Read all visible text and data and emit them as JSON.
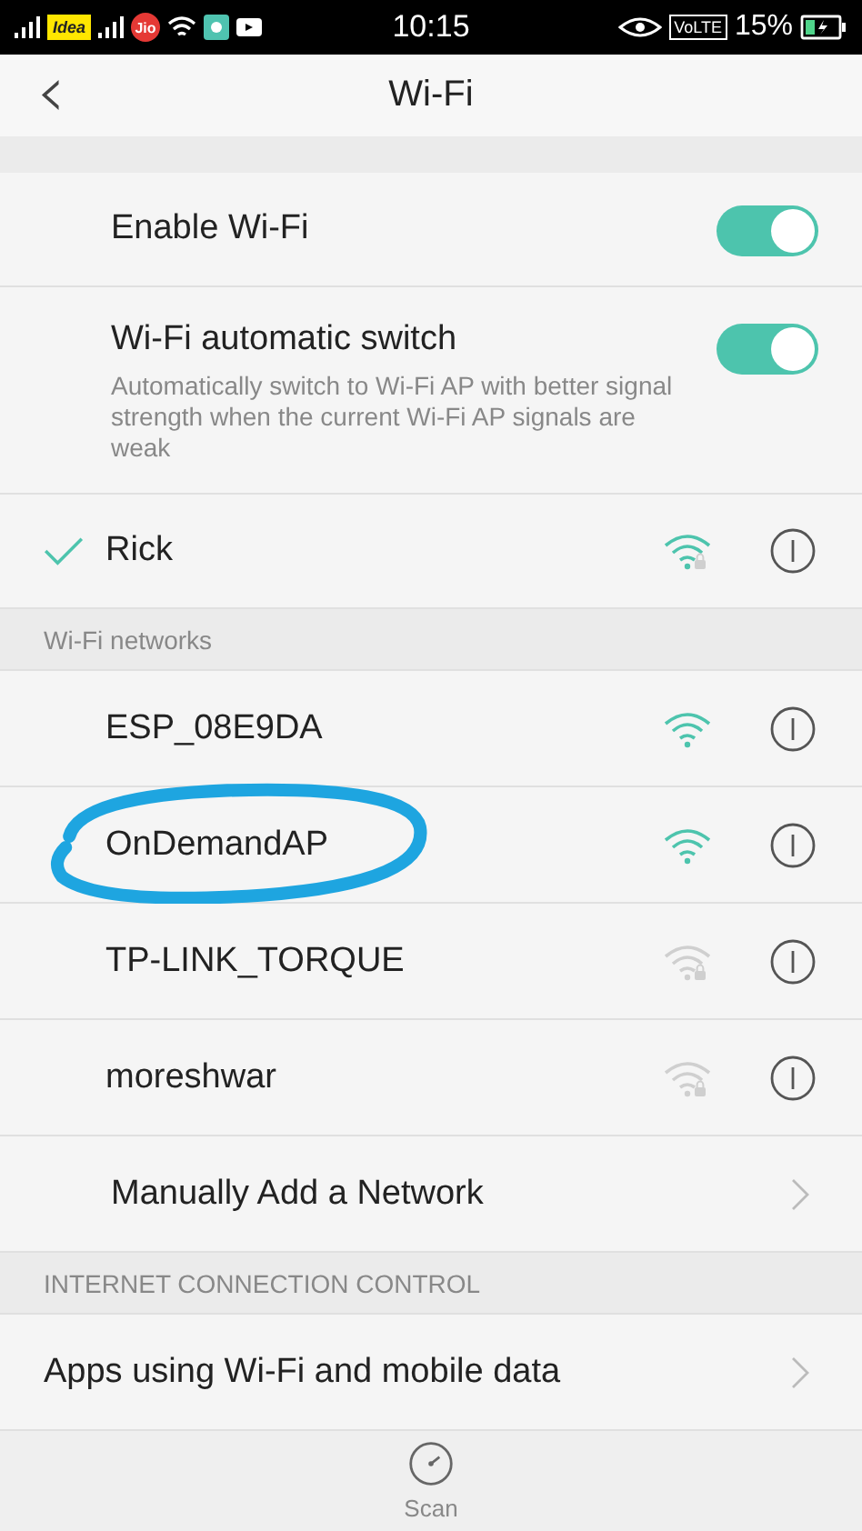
{
  "status_bar": {
    "carrier_1": "Idea",
    "carrier_2": "Jio",
    "time": "10:15",
    "volte": "VoLTE",
    "battery": "15%"
  },
  "header": {
    "back": "‹",
    "title": "Wi-Fi"
  },
  "toggles": [
    {
      "label": "Enable Wi-Fi",
      "on": true
    },
    {
      "label": "Wi-Fi automatic switch",
      "description": "Automatically switch to Wi-Fi AP with better signal strength when the current Wi-Fi AP signals are weak",
      "on": true
    }
  ],
  "connected": {
    "name": "Rick",
    "selected": true,
    "locked": true,
    "weak": false
  },
  "networks_header": "Wi-Fi networks",
  "networks": [
    {
      "name": "ESP_08E9DA",
      "locked": false,
      "weak": false,
      "circled": false
    },
    {
      "name": "OnDemandAP",
      "locked": false,
      "weak": false,
      "circled": true
    },
    {
      "name": "TP-LINK_TORQUE",
      "locked": true,
      "weak": true,
      "circled": false
    },
    {
      "name": "moreshwar",
      "locked": true,
      "weak": true,
      "circled": false
    }
  ],
  "manual_add": "Manually Add a Network",
  "internet_header": "INTERNET CONNECTION CONTROL",
  "apps_item": "Apps using Wi-Fi and mobile data",
  "bottom": {
    "scan": "Scan"
  }
}
